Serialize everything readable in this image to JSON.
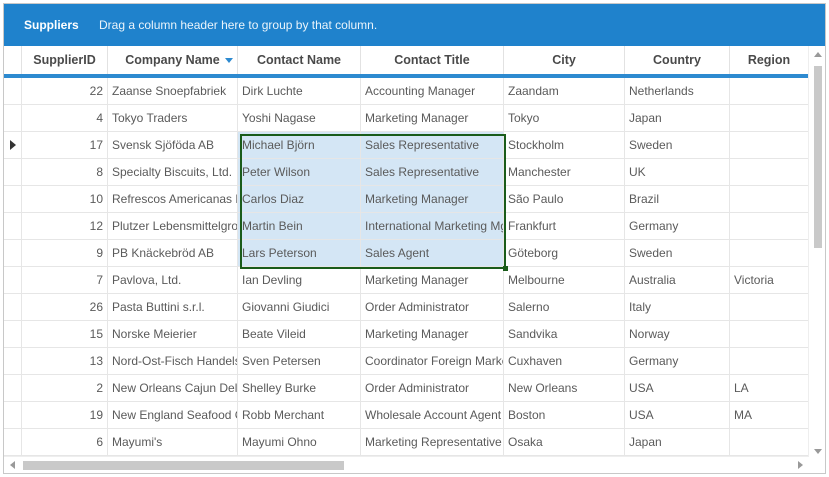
{
  "group_panel": {
    "title": "Suppliers",
    "hint": "Drag a column header here to group by that column."
  },
  "columns": [
    {
      "label": "SupplierID"
    },
    {
      "label": "Company Name",
      "sorted": true
    },
    {
      "label": "Contact Name"
    },
    {
      "label": "Contact Title"
    },
    {
      "label": "City"
    },
    {
      "label": "Country"
    },
    {
      "label": "Region"
    }
  ],
  "rows": [
    {
      "id": "22",
      "company": "Zaanse Snoepfabriek",
      "contact": "Dirk Luchte",
      "title": "Accounting Manager",
      "city": "Zaandam",
      "country": "Netherlands",
      "region": ""
    },
    {
      "id": "4",
      "company": "Tokyo Traders",
      "contact": "Yoshi Nagase",
      "title": "Marketing Manager",
      "city": "Tokyo",
      "country": "Japan",
      "region": ""
    },
    {
      "id": "17",
      "company": "Svensk Sjöföda AB",
      "contact": "Michael Björn",
      "title": "Sales Representative",
      "city": "Stockholm",
      "country": "Sweden",
      "region": "",
      "current": true,
      "selected": true
    },
    {
      "id": "8",
      "company": "Specialty Biscuits, Ltd.",
      "contact": "Peter Wilson",
      "title": "Sales Representative",
      "city": "Manchester",
      "country": "UK",
      "region": "",
      "selected": true
    },
    {
      "id": "10",
      "company": "Refrescos Americanas LTDA",
      "contact": "Carlos Diaz",
      "title": "Marketing Manager",
      "city": "São Paulo",
      "country": "Brazil",
      "region": "",
      "selected": true
    },
    {
      "id": "12",
      "company": "Plutzer Lebensmittelgroßmärkte AG",
      "contact": "Martin Bein",
      "title": "International Marketing Mgr.",
      "city": "Frankfurt",
      "country": "Germany",
      "region": "",
      "selected": true
    },
    {
      "id": "9",
      "company": "PB Knäckebröd AB",
      "contact": "Lars Peterson",
      "title": "Sales Agent",
      "city": "Göteborg",
      "country": "Sweden",
      "region": "",
      "selected": true
    },
    {
      "id": "7",
      "company": "Pavlova, Ltd.",
      "contact": "Ian Devling",
      "title": "Marketing Manager",
      "city": "Melbourne",
      "country": "Australia",
      "region": "Victoria"
    },
    {
      "id": "26",
      "company": "Pasta Buttini s.r.l.",
      "contact": "Giovanni Giudici",
      "title": "Order Administrator",
      "city": "Salerno",
      "country": "Italy",
      "region": ""
    },
    {
      "id": "15",
      "company": "Norske Meierier",
      "contact": "Beate Vileid",
      "title": "Marketing Manager",
      "city": "Sandvika",
      "country": "Norway",
      "region": ""
    },
    {
      "id": "13",
      "company": "Nord-Ost-Fisch Handelsgesellschaft mbH",
      "contact": "Sven Petersen",
      "title": "Coordinator Foreign Markets",
      "city": "Cuxhaven",
      "country": "Germany",
      "region": ""
    },
    {
      "id": "2",
      "company": "New Orleans Cajun Delights",
      "contact": "Shelley Burke",
      "title": "Order Administrator",
      "city": "New Orleans",
      "country": "USA",
      "region": "LA"
    },
    {
      "id": "19",
      "company": "New England Seafood Cannery",
      "contact": "Robb Merchant",
      "title": "Wholesale Account Agent",
      "city": "Boston",
      "country": "USA",
      "region": "MA"
    },
    {
      "id": "6",
      "company": "Mayumi's",
      "contact": "Mayumi Ohno",
      "title": "Marketing Representative",
      "city": "Osaka",
      "country": "Japan",
      "region": ""
    }
  ]
}
